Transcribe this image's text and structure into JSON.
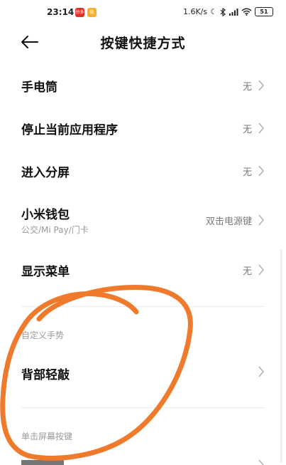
{
  "status_bar": {
    "time": "23:14",
    "app_badge_1": "拼多",
    "app_badge_2": "微",
    "net_speed": "1.6K/s",
    "battery": "51",
    "icons": [
      "moon-icon",
      "bluetooth-icon",
      "signal-icon",
      "wifi-icon",
      "battery-icon"
    ]
  },
  "header": {
    "title": "按键快捷方式",
    "back_icon": "back-arrow-icon"
  },
  "rows": [
    {
      "title": "手电筒",
      "value": "无"
    },
    {
      "title": "停止当前应用程序",
      "value": "无"
    },
    {
      "title": "进入分屏",
      "value": "无"
    },
    {
      "title": "小米钱包",
      "subtitle": "公交/Mi Pay/门卡",
      "value": "双击电源键"
    },
    {
      "title": "显示菜单",
      "value": "无"
    }
  ],
  "section_gesture": {
    "label": "自定义手势",
    "row_title": "背部轻敲"
  },
  "section_button": {
    "label": "单击屏幕按键"
  },
  "colors": {
    "annotation": "#f07a2c",
    "secondary_text": "#9a9a9a"
  }
}
